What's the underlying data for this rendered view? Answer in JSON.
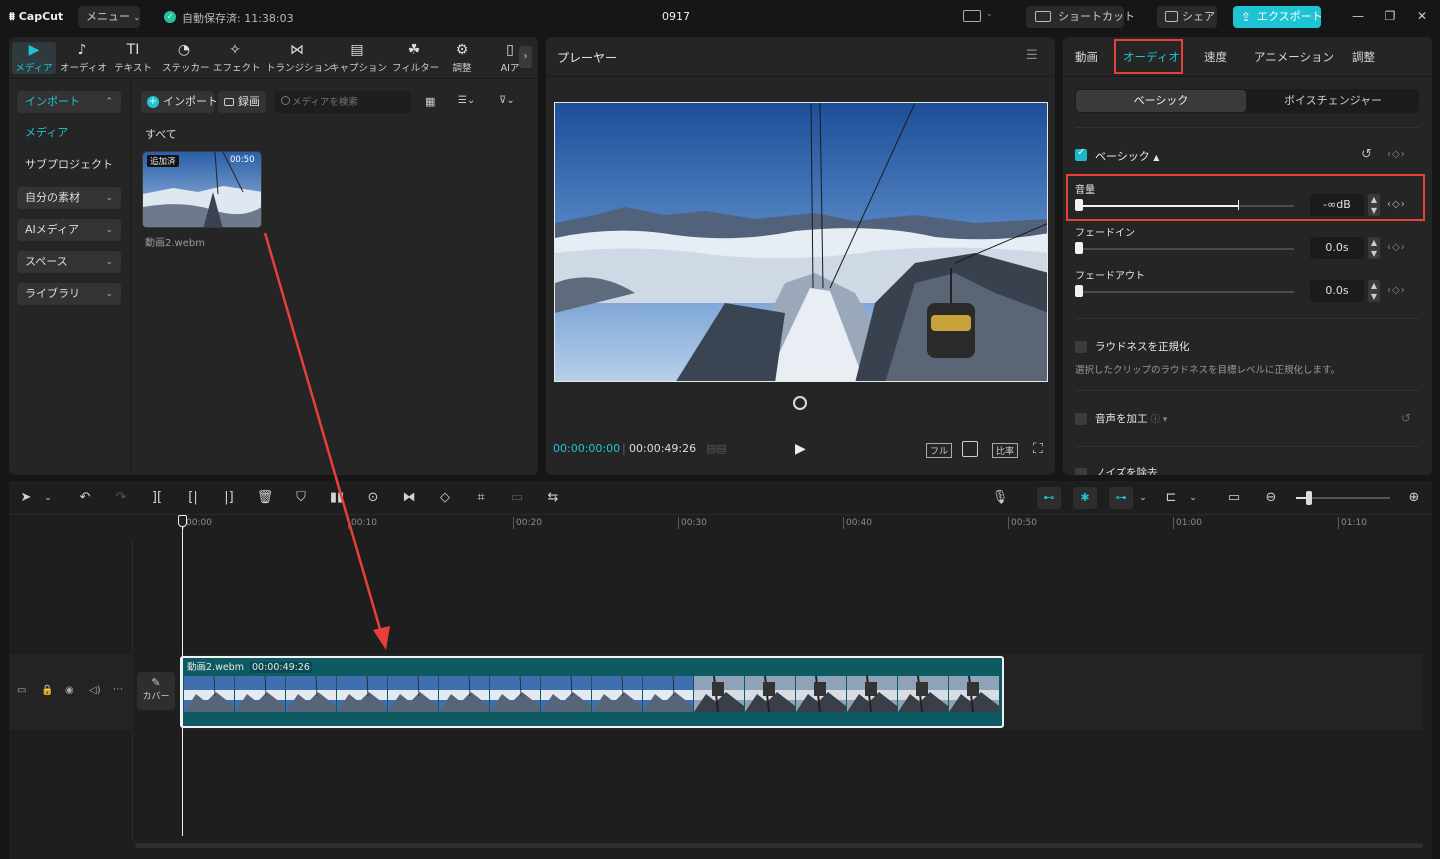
{
  "titlebar": {
    "logo": "CapCut",
    "menu": "メニュー",
    "autosave": "自動保存済: 11:38:03",
    "project": "0917",
    "shortcut": "ショートカット",
    "share": "シェア",
    "export": "エクスポート"
  },
  "tooltabs": [
    {
      "label": "メディア",
      "icon": "media-icon"
    },
    {
      "label": "オーディオ",
      "icon": "audio-icon"
    },
    {
      "label": "テキスト",
      "icon": "text-icon"
    },
    {
      "label": "ステッカー",
      "icon": "sticker-icon"
    },
    {
      "label": "エフェクト",
      "icon": "effect-icon"
    },
    {
      "label": "トランジション",
      "icon": "transition-icon"
    },
    {
      "label": "キャプション",
      "icon": "caption-icon"
    },
    {
      "label": "フィルター",
      "icon": "filter-icon"
    },
    {
      "label": "調整",
      "icon": "adjust-icon"
    },
    {
      "label": "AIア",
      "icon": "ai-icon"
    }
  ],
  "sidebar": {
    "items": [
      {
        "label": "インポート",
        "chevron": "⌃"
      },
      {
        "label": "メディア",
        "chevron": ""
      },
      {
        "label": "サブプロジェクト",
        "chevron": ""
      },
      {
        "label": "自分の素材",
        "chevron": "⌄"
      },
      {
        "label": "AIメディア",
        "chevron": "⌄"
      },
      {
        "label": "スペース",
        "chevron": "⌄"
      },
      {
        "label": "ライブラリ",
        "chevron": "⌄"
      }
    ]
  },
  "media": {
    "import_btn": "インポート",
    "record_btn": "録画",
    "search_placeholder": "メディアを検索",
    "filter_all": "すべて",
    "clip_badge": "追加済",
    "clip_duration": "00:50",
    "clip_name": "動画2.webm"
  },
  "player": {
    "title": "プレーヤー",
    "current_time": "00:00:00:00",
    "total_time": "00:00:49:26",
    "full_btn": "フル",
    "ratio_btn": "比率"
  },
  "inspector": {
    "tabs": [
      "動画",
      "オーディオ",
      "速度",
      "アニメーション",
      "調整"
    ],
    "subtabs": [
      "ベーシック",
      "ボイスチェンジャー"
    ],
    "basic_section": "ベーシック",
    "volume_label": "音量",
    "volume_value": "-∞dB",
    "fadein_label": "フェードイン",
    "fadein_value": "0.0s",
    "fadeout_label": "フェードアウト",
    "fadeout_value": "0.0s",
    "loudness_label": "ラウドネスを正規化",
    "loudness_desc": "選択したクリップのラウドネスを目標レベルに正規化します。",
    "enhance_label": "音声を加工",
    "noise_label": "ノイズを除去"
  },
  "timeline": {
    "ticks": [
      "00:00",
      "00:10",
      "00:20",
      "00:30",
      "00:40",
      "00:50",
      "01:00",
      "01:10"
    ],
    "clip_name": "動画2.webm",
    "clip_duration": "00:00:49:26",
    "cover_label": "カバー"
  },
  "colors": {
    "accent": "#1fc4d4",
    "highlight": "#e5413a",
    "clip": "#0d5a63"
  }
}
